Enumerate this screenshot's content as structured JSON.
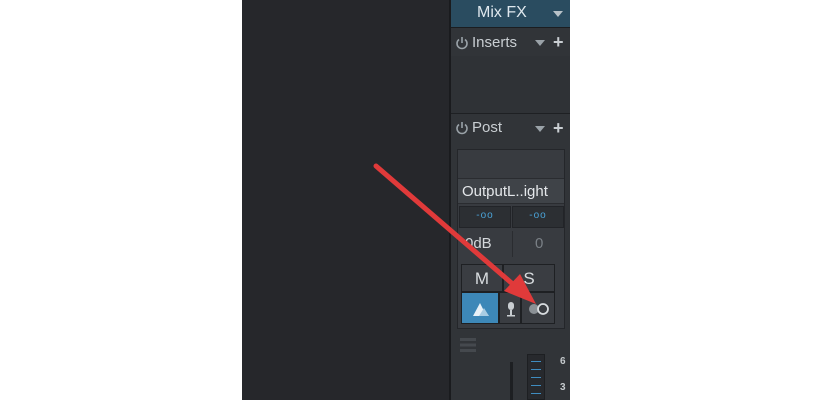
{
  "mixfx": {
    "label": "Mix FX"
  },
  "inserts": {
    "label": "Inserts",
    "add_symbol": "+"
  },
  "post": {
    "label": "Post",
    "add_symbol": "+"
  },
  "channel": {
    "name": "OutputL..ight",
    "meter_left": "-oo",
    "meter_right": "-oo",
    "volume": "0dB",
    "pan": "0"
  },
  "buttons": {
    "mute": "M",
    "solo": "S"
  },
  "scale": [
    "6",
    "3"
  ],
  "colors": {
    "accent": "#3d88b8",
    "header": "#2a4c60",
    "arrow": "#e03a3a"
  },
  "icons": [
    "power-icon",
    "chevron-down-icon",
    "plus-icon",
    "automation-icon",
    "input-monitor-icon",
    "link-toggle-icon",
    "fader-menu-icon"
  ]
}
